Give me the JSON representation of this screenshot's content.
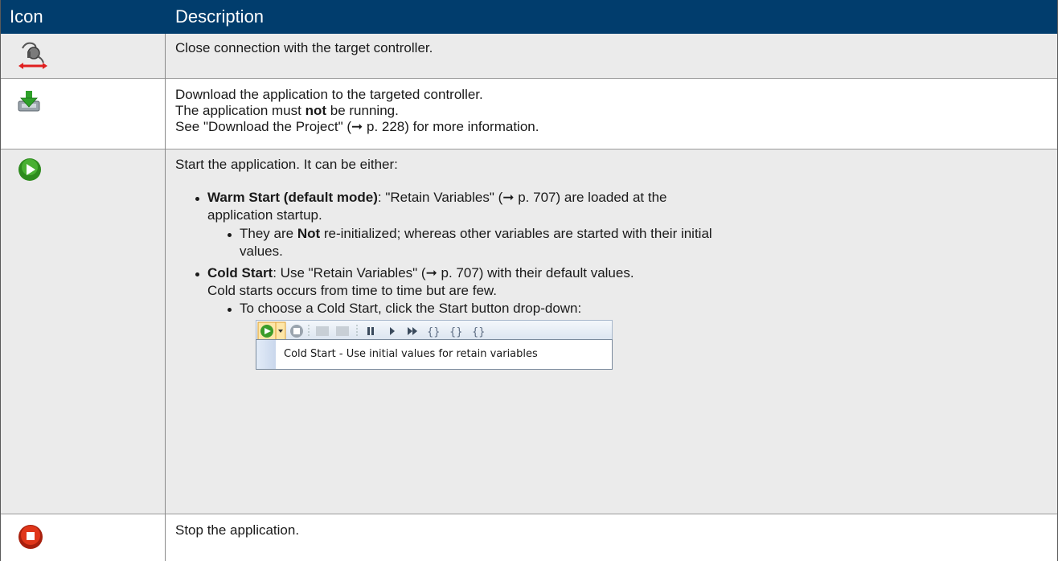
{
  "header": {
    "col_icon": "Icon",
    "col_description": "Description"
  },
  "rows": {
    "close": {
      "icon": "disconnect-icon",
      "text": "Close connection with the target controller."
    },
    "download": {
      "icon": "download-icon",
      "line1": "Download the application to the targeted controller.",
      "line2_pre": "The application must ",
      "line2_bold": "not",
      "line2_post": " be running.",
      "line3": "See \"Download the Project\" (➞ p. 228) for more information."
    },
    "start": {
      "icon": "start-icon",
      "intro": "Start the application. It can be either:",
      "warm_bold": "Warm Start (default mode)",
      "warm_text1": ": \"Retain Variables\" (➞ p. 707) are loaded at the",
      "warm_text2": "application startup.",
      "warm_sub_pre": "They are ",
      "warm_sub_bold": "Not",
      "warm_sub_post1": " re-initialized; whereas other variables are started with their initial",
      "warm_sub_post2": "values.",
      "cold_bold": "Cold Start",
      "cold_text": ": Use \"Retain Variables\" (➞ p. 707) with their default values.",
      "cold_line2": "Cold starts occurs from time to time but are few.",
      "cold_sub": "To choose a Cold Start, click the Start button drop-down:",
      "menu_item": "Cold Start - Use initial values for retain variables"
    },
    "stop": {
      "icon": "stop-icon",
      "text": "Stop the application."
    }
  },
  "colors": {
    "header_bg": "#013d6d",
    "shade_bg": "#ebebeb",
    "start_green": "#2e8b1e",
    "stop_red": "#d22a10"
  }
}
